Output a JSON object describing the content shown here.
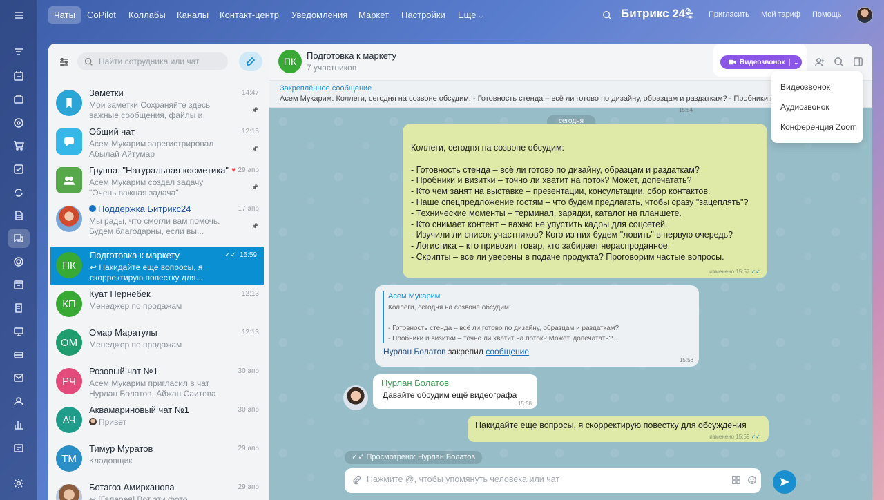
{
  "topnav": {
    "items": [
      "Чаты",
      "CoPilot",
      "Коллабы",
      "Каналы",
      "Контакт-центр",
      "Уведомления",
      "Маркет",
      "Настройки",
      "Еще"
    ],
    "brand": "Битрикс 24",
    "invite": "Пригласить",
    "tariff": "Мой тариф",
    "help": "Помощь"
  },
  "rail_icons": [
    "menu-icon",
    "feed-icon",
    "tasks-icon",
    "calendar-icon",
    "crm-icon",
    "shop-icon",
    "check-icon",
    "sync-icon",
    "docs-icon",
    "chat-icon",
    "sites-icon",
    "schedule-icon",
    "reports-icon",
    "drive-icon",
    "card-icon",
    "mail-icon",
    "contacts-icon",
    "analytics-icon",
    "widget-icon",
    "settings-icon"
  ],
  "list": {
    "search_placeholder": "Найти сотрудника или чат",
    "chats": [
      {
        "initials": "",
        "title": "Заметки",
        "time": "14:47",
        "sub": "Мои заметки Сохраняйте здесь важные сообщения, файлы и ссылки",
        "pinned": true,
        "color": "#2aa5d6"
      },
      {
        "initials": "",
        "title": "Общий чат",
        "time": "12:15",
        "sub": "Асем Мукарим зарегистрировал Абылай Айтумар",
        "pinned": true,
        "color": "#35b7e8"
      },
      {
        "initials": "",
        "title": "Группа: \"Натуральная косметика\"",
        "time": "29 апр",
        "sub": "Асем Мукарим создал задачу \"Очень важная задача\"",
        "pinned": true,
        "color": "#56a84a"
      },
      {
        "initials": "",
        "title": "Поддержка Битрикс24",
        "time": "17 апр",
        "sub": "Мы рады, что смогли вам помочь. Будем благодарны, если вы...",
        "pinned": true,
        "color": "#1a6fbf"
      },
      {
        "initials": "ПК",
        "title": "Подготовка к маркету",
        "time": "15:59",
        "sub": "↩ Накидайте еще вопросы, я скорректирую повестку для...",
        "pinned": false,
        "color": "#39a935"
      },
      {
        "initials": "КП",
        "title": "Куат Пернебек",
        "time": "12:13",
        "sub": "Менеджер по продажам",
        "pinned": false,
        "color": "#39a935"
      },
      {
        "initials": "ОМ",
        "title": "Омар Маратулы",
        "time": "12:13",
        "sub": "Менеджер по продажам",
        "pinned": false,
        "color": "#1f9d6e"
      },
      {
        "initials": "РЧ",
        "title": "Розовый чат №1",
        "time": "30 апр",
        "sub": "Асем Мукарим пригласил в чат Нурлан Болатов, Айжан Саитова",
        "pinned": false,
        "color": "#e24b7a"
      },
      {
        "initials": "АЧ",
        "title": "Аквамариновый чат №1",
        "time": "30 апр",
        "sub": "Привет",
        "pinned": false,
        "color": "#1f9d8a"
      },
      {
        "initials": "ТМ",
        "title": "Тимур Муратов",
        "time": "29 апр",
        "sub": "Кладовщик",
        "pinned": false,
        "color": "#2a8fc7"
      },
      {
        "initials": "",
        "title": "Ботагоз Амирханова",
        "time": "29 апр",
        "sub": "↩ [Галерея] Вот эти фото",
        "pinned": false,
        "color": "#b9c7d6"
      }
    ]
  },
  "chat": {
    "initials": "ПК",
    "title": "Подготовка к маркету",
    "members": "7 участников",
    "video_button": "Видеозвонок",
    "pinned_label": "Закреплённое сообщение",
    "pinned_text": "Асем Мукарим: Коллеги, сегодня на созвоне обсудим: - Готовность стенда – всё ли готово по дизайну, образцам и раздаткам? - Пробники и визи",
    "top_time": "15:54",
    "date_divider": "сегодня",
    "big_message_lines": [
      "Коллеги, сегодня на созвоне обсудим:",
      "",
      "- Готовность стенда – всё ли готово по дизайну, образцам и раздаткам?",
      "- Пробники и визитки – точно ли хватит на поток? Может, допечатать?",
      "- Кто чем занят на выставке – презентации, консультации, сбор контактов.",
      "- Наше спецпредложение гостям – что будем предлагать, чтобы сразу \"зацеплять\"?",
      "- Технические моменты – терминал, зарядки, каталог на планшете.",
      "- Кто снимает контент – важно не упустить кадры для соцсетей.",
      "- Изучили ли список участников? Кого из них будем \"ловить\" в первую очередь?",
      "- Логистика – кто привозит товар, кто забирает нераспроданное.",
      "- Скрипты – все ли уверены в подаче продукта? Проговорим частые вопросы."
    ],
    "big_message_meta": "изменено 15:57",
    "quote": {
      "author": "Асем Мукарим",
      "lines": [
        "Коллеги, сегодня на созвоне обсудим:",
        "",
        "- Готовность стенда – всё ли готово по дизайну, образцам и раздаткам?",
        "- Пробники и визитки – точно ли хватит на поток? Может, допечатать?..."
      ],
      "who": "Нурлан Болатов",
      "action": "закрепил",
      "link": "сообщение",
      "time": "15:58"
    },
    "nurlan": {
      "name": "Нурлан Болатов",
      "text": "Давайте обсудим ещё видеографа",
      "time": "15:58"
    },
    "mine": {
      "text": "Накидайте еще вопросы, я скорректирую повестку для обсуждения",
      "meta": "изменено 15:59"
    },
    "seen": "Просмотрено: Нурлан Болатов",
    "composer_placeholder": "Нажмите @, чтобы упомянуть человека или чат"
  },
  "dropdown": {
    "items": [
      "Видеозвонок",
      "Аудиозвонок",
      "Конференция Zoom"
    ]
  },
  "colors": {
    "accent": "#1a8fcf",
    "video": "#8b55e8",
    "bubble_mine": "#dfe9a8",
    "active_chat": "#0a8fd2"
  }
}
